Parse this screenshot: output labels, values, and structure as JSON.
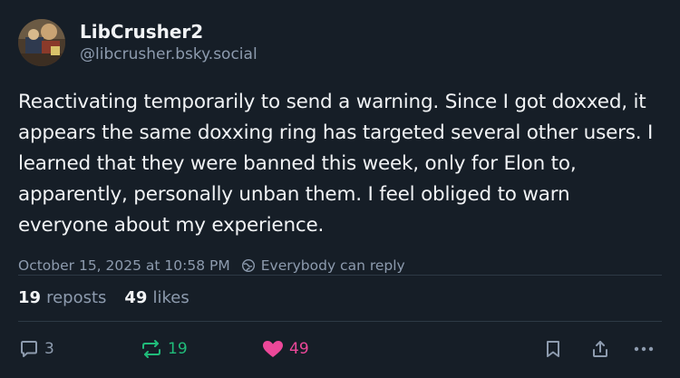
{
  "author": {
    "display_name": "LibCrusher2",
    "handle": "@libcrusher.bsky.social"
  },
  "post": {
    "text": "Reactivating temporarily to send a warning. Since I got doxxed, it appears the same doxxing ring has targeted several other users. I learned that they were banned this week, only for Elon to, apparently, personally unban them. I feel obliged to warn everyone about my experience.",
    "timestamp": "October 15, 2025 at 10:58 PM",
    "reply_setting": "Everybody can reply"
  },
  "stats": {
    "reposts_count": "19",
    "reposts_label": "reposts",
    "likes_count": "49",
    "likes_label": "likes"
  },
  "actions": {
    "reply_count": "3",
    "repost_count": "19",
    "like_count": "49"
  },
  "colors": {
    "background": "#161e27",
    "text": "#f1f3f5",
    "muted": "#8d9bae",
    "repost_accent": "#20bc7a",
    "like_accent": "#ec4899"
  }
}
